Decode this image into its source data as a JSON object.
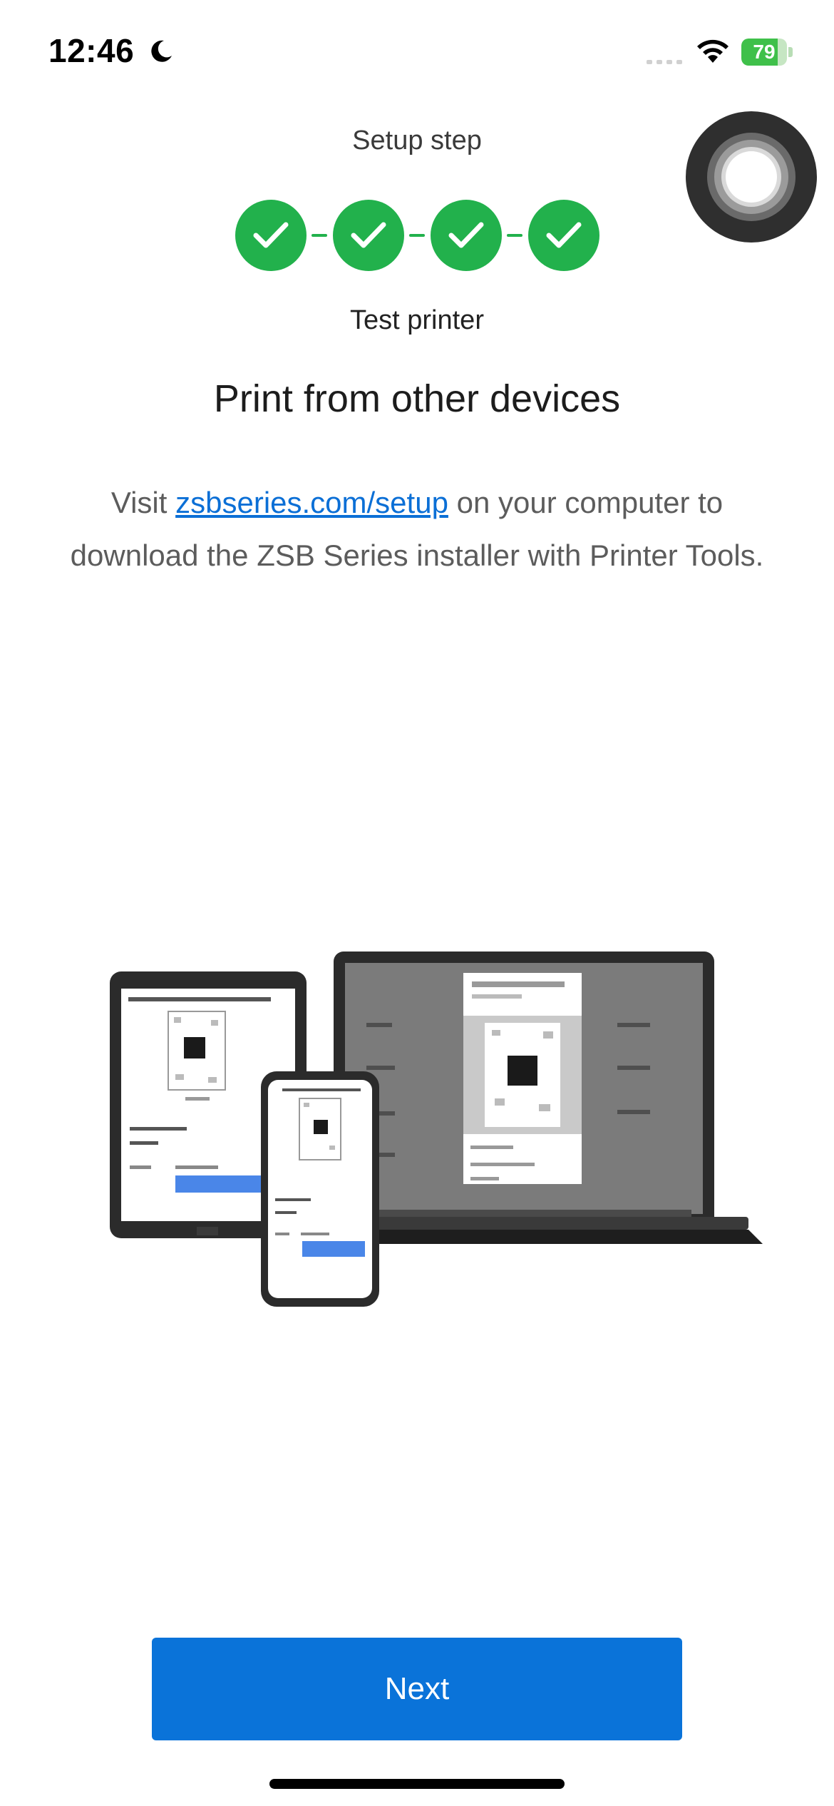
{
  "status_bar": {
    "time": "12:46",
    "battery_level": "79",
    "battery_fraction": 0.79,
    "icons": [
      "moon-icon",
      "cellular-signal-icon",
      "wifi-icon",
      "battery-icon"
    ]
  },
  "setup": {
    "header_label": "Setup step",
    "steps_total": 4,
    "steps_completed": 4,
    "current_step_name": "Test printer",
    "step_icon": "checkmark-icon",
    "accent_color": "#22b14c"
  },
  "main": {
    "title": "Print from other devices",
    "description_prefix": "Visit ",
    "link_text": "zsbseries.com/setup",
    "description_suffix": " on your computer to download the ZSB Series installer with Printer Tools.",
    "illustration": "devices-illustration"
  },
  "footer": {
    "next_label": "Next",
    "button_color": "#0a73d9"
  }
}
